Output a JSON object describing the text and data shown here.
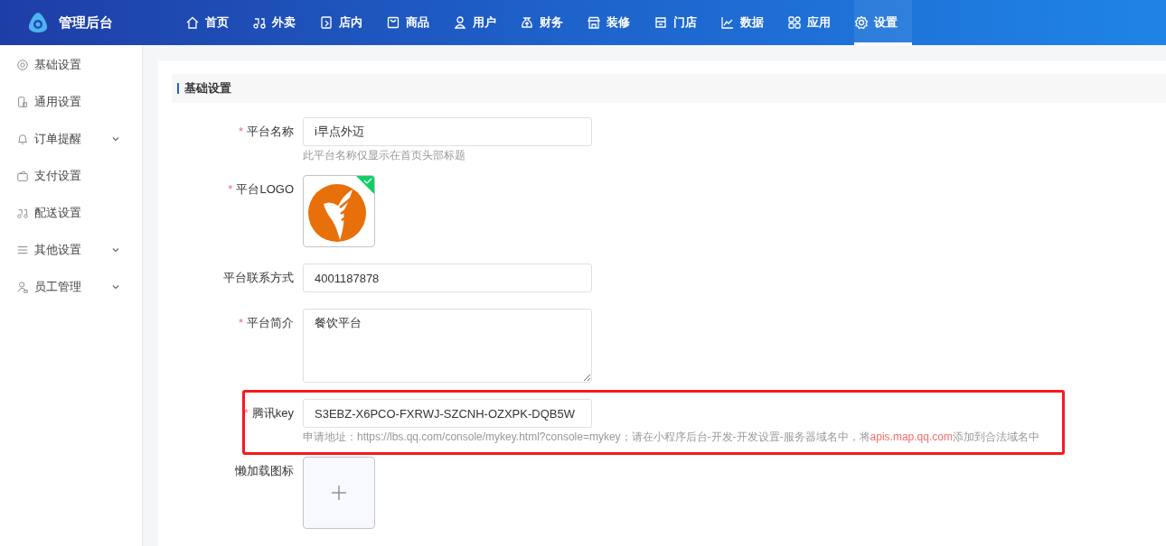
{
  "brand": {
    "title": "管理后台"
  },
  "nav": [
    {
      "label": "首页",
      "selected": false
    },
    {
      "label": "外卖",
      "selected": false
    },
    {
      "label": "店内",
      "selected": false
    },
    {
      "label": "商品",
      "selected": false
    },
    {
      "label": "用户",
      "selected": false
    },
    {
      "label": "财务",
      "selected": false
    },
    {
      "label": "装修",
      "selected": false
    },
    {
      "label": "门店",
      "selected": false
    },
    {
      "label": "数据",
      "selected": false
    },
    {
      "label": "应用",
      "selected": false
    },
    {
      "label": "设置",
      "selected": true
    }
  ],
  "sidebar": {
    "items": [
      {
        "label": "基础设置",
        "expandable": false,
        "selected": false
      },
      {
        "label": "通用设置",
        "expandable": false,
        "selected": false
      },
      {
        "label": "订单提醒",
        "expandable": true,
        "selected": false
      },
      {
        "label": "支付设置",
        "expandable": false,
        "selected": false
      },
      {
        "label": "配送设置",
        "expandable": false,
        "selected": false
      },
      {
        "label": "其他设置",
        "expandable": true,
        "selected": false
      },
      {
        "label": "员工管理",
        "expandable": true,
        "selected": false
      }
    ]
  },
  "section": {
    "title": "基础设置"
  },
  "form": [
    {
      "kind": "input",
      "label": "平台名称",
      "marker": "*",
      "value": "i早点外迈",
      "hint": "此平台名称仅显示在首页头部标题"
    },
    {
      "kind": "image",
      "label": "平台LOGO",
      "marker": "*",
      "uploaded": true
    },
    {
      "kind": "input",
      "label": "平台联系方式",
      "value": "4001187878"
    },
    {
      "kind": "textarea",
      "label": "平台简介",
      "marker": "*",
      "value": "餐饮平台"
    },
    {
      "kind": "input",
      "label": "腾讯key",
      "marker": "*",
      "highlighted": true,
      "value": "S3EBZ-X6PCO-FXRWJ-SZCNH-OZXPK-DQB5W",
      "hint_parts": {
        "prefix": "申请地址：https://lbs.qq.com/console/mykey.html?console=mykey；请在小程序后台-开发-开发设置-服务器域名中，将",
        "link": "apis.map.qq.com",
        "suffix": "添加到合法域名中"
      }
    },
    {
      "kind": "upload",
      "label": "懒加载图标"
    }
  ]
}
